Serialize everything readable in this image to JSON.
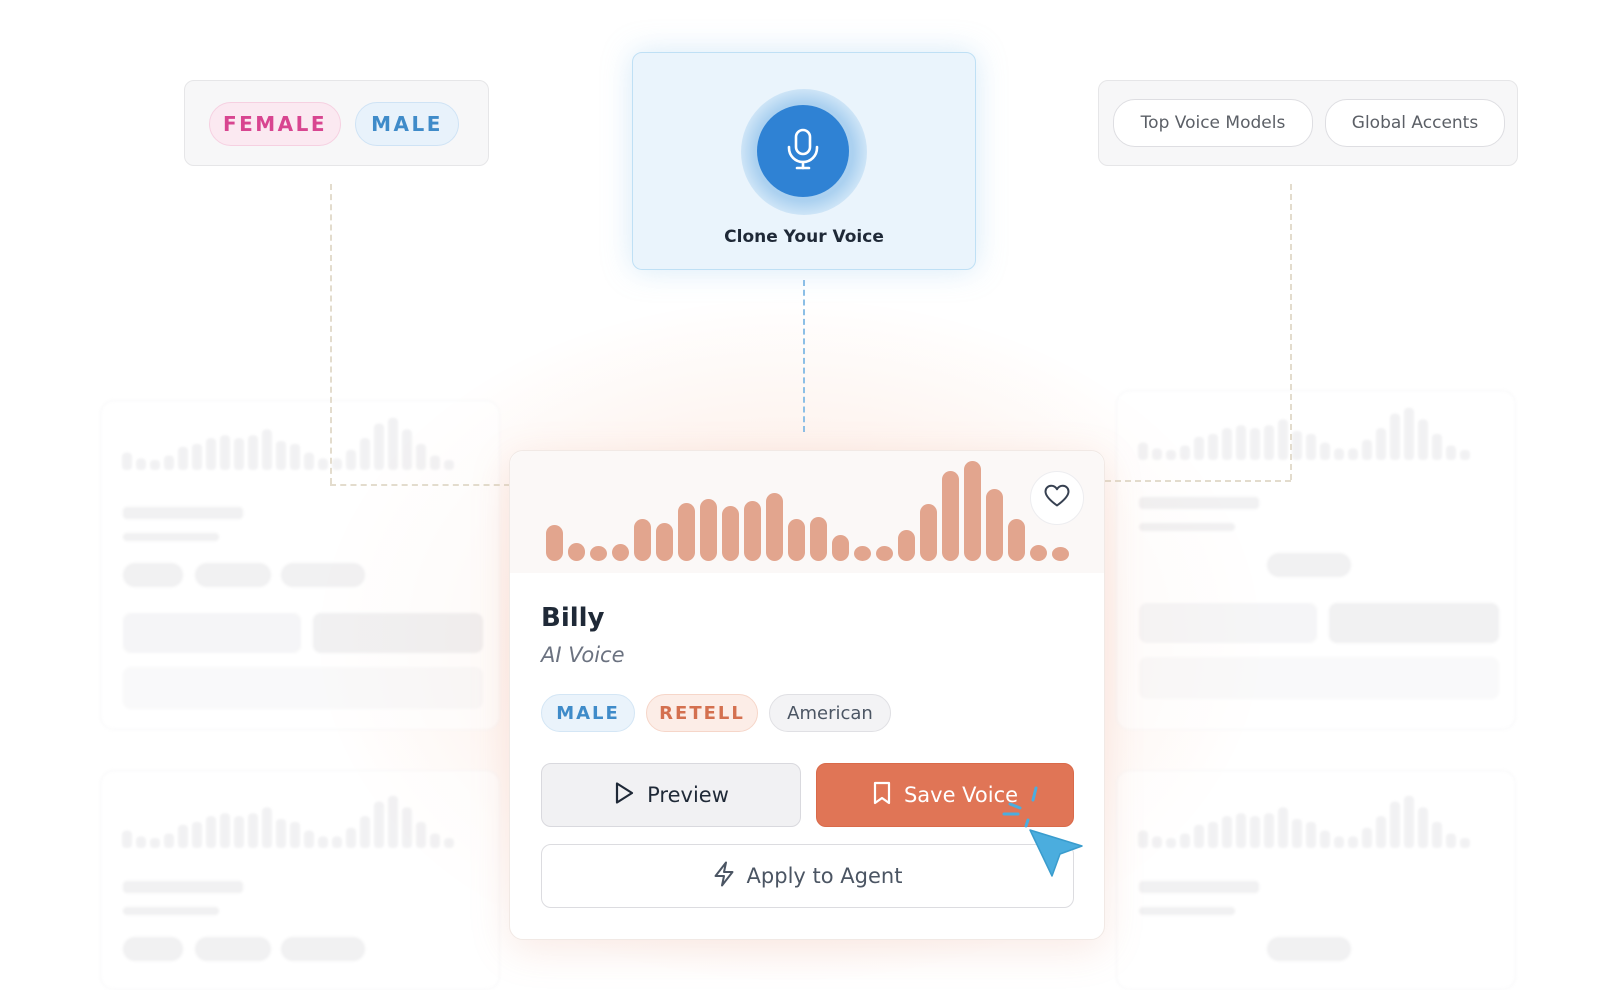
{
  "filters": {
    "gender": [
      "FEMALE",
      "MALE"
    ],
    "categories": [
      "Top Voice Models",
      "Global Accents"
    ]
  },
  "clone": {
    "label": "Clone Your Voice",
    "icon": "microphone-icon"
  },
  "voice_card": {
    "name": "Billy",
    "type": "AI Voice",
    "tags": [
      "MALE",
      "RETELL",
      "American"
    ],
    "waveform_levels": [
      0.36,
      0.18,
      0.15,
      0.17,
      0.42,
      0.38,
      0.58,
      0.62,
      0.55,
      0.6,
      0.68,
      0.42,
      0.44,
      0.26,
      0.15,
      0.15,
      0.31,
      0.57,
      0.9,
      1.0,
      0.72,
      0.42,
      0.16,
      0.1
    ],
    "actions": {
      "preview": "Preview",
      "save": "Save Voice",
      "apply": "Apply to Agent"
    },
    "favorite_icon": "heart-icon"
  },
  "colors": {
    "accent_orange": "#e07556",
    "waveform": "#e2a58e",
    "male_blue": "#3f8bc9",
    "female_pink": "#d84590",
    "mic_blue": "#2f82d4",
    "cursor_blue": "#4badde"
  }
}
